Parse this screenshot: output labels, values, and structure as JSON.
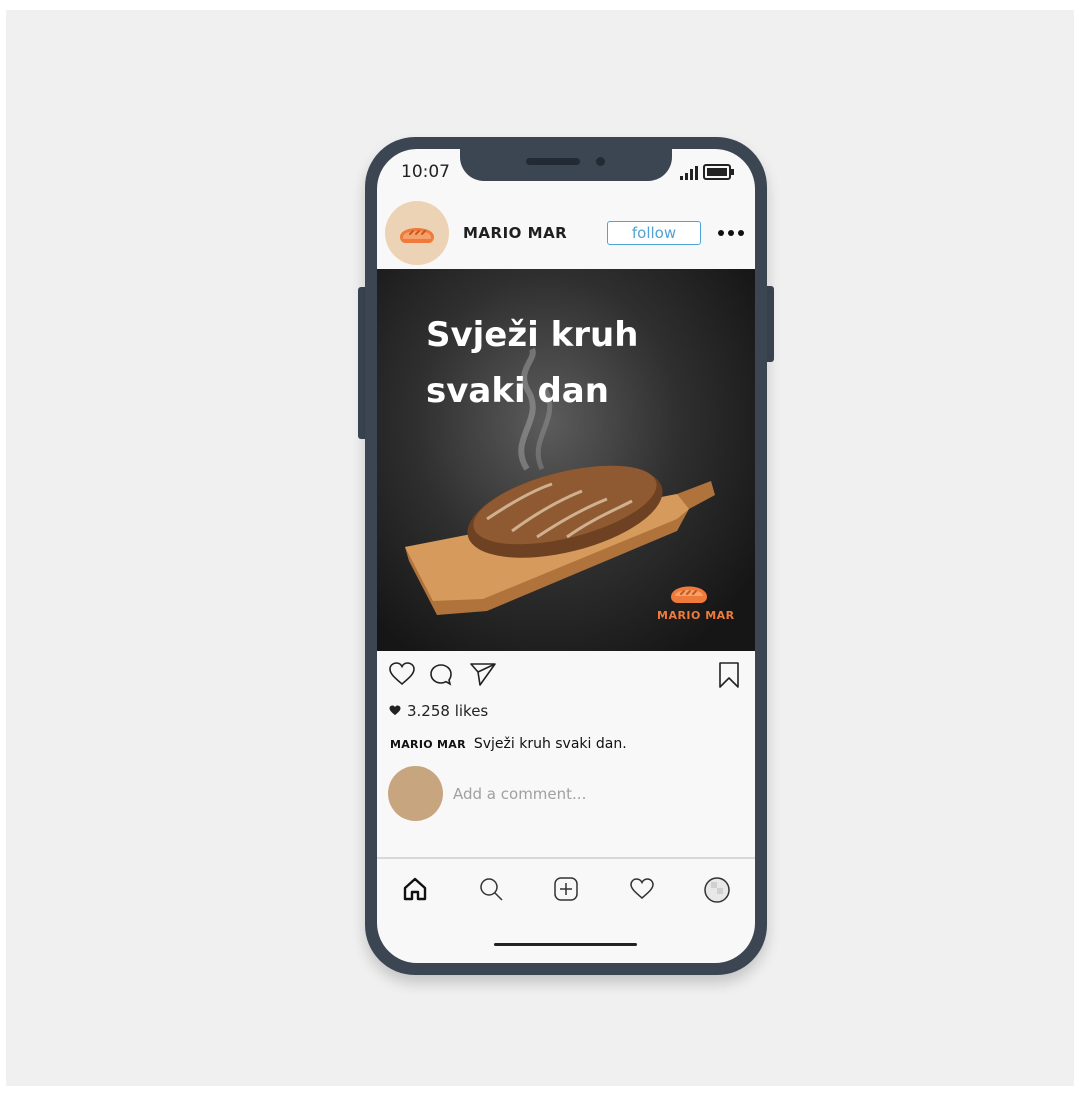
{
  "status_bar": {
    "time": "10:07"
  },
  "header": {
    "username": "MARIO MAR",
    "follow_label": "follow"
  },
  "post": {
    "headline_line1": "Svježi kruh",
    "headline_line2": "svaki dan",
    "logo_text": "MARIO MAR"
  },
  "engagement": {
    "likes": "3.258 likes",
    "caption_user": "MARIO MAR",
    "caption_text": "Svježi kruh svaki dan."
  },
  "comment": {
    "placeholder": "Add a comment..."
  },
  "colors": {
    "frame": "#3c4653",
    "accent_blue": "#4fa3d8",
    "brand_orange": "#ef7a3a",
    "avatar_bg": "#ecd3b6"
  },
  "icons": {
    "actions": [
      "heart-icon",
      "comment-icon",
      "send-icon",
      "bookmark-icon"
    ],
    "nav": [
      "home-icon",
      "search-icon",
      "add-post-icon",
      "activity-heart-icon",
      "profile-icon"
    ]
  }
}
